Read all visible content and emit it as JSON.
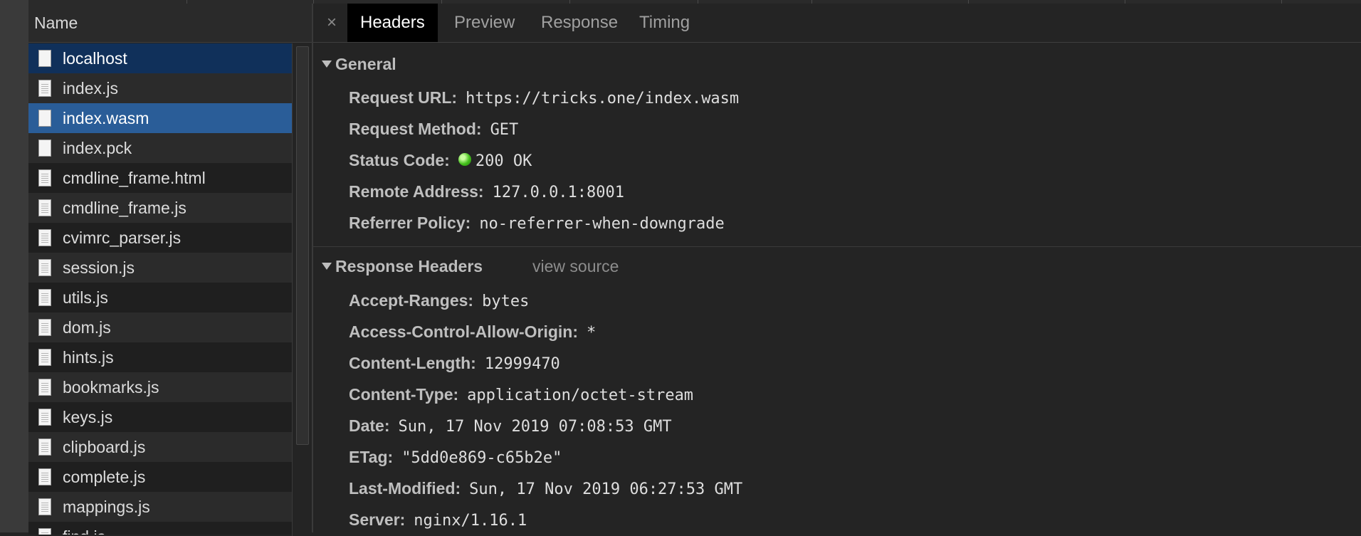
{
  "requests": {
    "column_header": "Name",
    "items": [
      {
        "name": "localhost",
        "state": "focused",
        "icon": "document-icon"
      },
      {
        "name": "index.js",
        "state": "",
        "icon": "script-file-icon"
      },
      {
        "name": "index.wasm",
        "state": "selected",
        "icon": "document-icon"
      },
      {
        "name": "index.pck",
        "state": "",
        "icon": "document-icon"
      },
      {
        "name": "cmdline_frame.html",
        "state": "",
        "icon": "script-file-icon"
      },
      {
        "name": "cmdline_frame.js",
        "state": "",
        "icon": "script-file-icon"
      },
      {
        "name": "cvimrc_parser.js",
        "state": "",
        "icon": "script-file-icon"
      },
      {
        "name": "session.js",
        "state": "",
        "icon": "script-file-icon"
      },
      {
        "name": "utils.js",
        "state": "",
        "icon": "script-file-icon"
      },
      {
        "name": "dom.js",
        "state": "",
        "icon": "script-file-icon"
      },
      {
        "name": "hints.js",
        "state": "",
        "icon": "script-file-icon"
      },
      {
        "name": "bookmarks.js",
        "state": "",
        "icon": "script-file-icon"
      },
      {
        "name": "keys.js",
        "state": "",
        "icon": "script-file-icon"
      },
      {
        "name": "clipboard.js",
        "state": "",
        "icon": "script-file-icon"
      },
      {
        "name": "complete.js",
        "state": "",
        "icon": "script-file-icon"
      },
      {
        "name": "mappings.js",
        "state": "",
        "icon": "script-file-icon"
      },
      {
        "name": "find.js",
        "state": "",
        "icon": "script-file-icon"
      }
    ]
  },
  "tabs": {
    "close_icon": "×",
    "items": [
      {
        "label": "Headers",
        "active": true
      },
      {
        "label": "Preview",
        "active": false
      },
      {
        "label": "Response",
        "active": false
      },
      {
        "label": "Timing",
        "active": false
      }
    ]
  },
  "general": {
    "title": "General",
    "rows": [
      {
        "key": "Request URL:",
        "value": "https://tricks.one/index.wasm"
      },
      {
        "key": "Request Method:",
        "value": "GET"
      },
      {
        "key": "Status Code:",
        "value": "200 OK",
        "status_color": "#44c11c"
      },
      {
        "key": "Remote Address:",
        "value": "127.0.0.1:8001"
      },
      {
        "key": "Referrer Policy:",
        "value": "no-referrer-when-downgrade"
      }
    ]
  },
  "response_headers": {
    "title": "Response Headers",
    "view_source": "view source",
    "rows": [
      {
        "key": "Accept-Ranges:",
        "value": "bytes"
      },
      {
        "key": "Access-Control-Allow-Origin:",
        "value": "*"
      },
      {
        "key": "Content-Length:",
        "value": "12999470"
      },
      {
        "key": "Content-Type:",
        "value": "application/octet-stream"
      },
      {
        "key": "Date:",
        "value": "Sun, 17 Nov 2019 07:08:53 GMT"
      },
      {
        "key": "ETag:",
        "value": "\"5dd0e869-c65b2e\""
      },
      {
        "key": "Last-Modified:",
        "value": "Sun, 17 Nov 2019 06:27:53 GMT"
      },
      {
        "key": "Server:",
        "value": "nginx/1.16.1"
      }
    ]
  },
  "colors": {
    "selected_row": "#2a5d98",
    "focused_row": "#10305a",
    "active_tab": "#000000",
    "status_ok": "#44c11c"
  }
}
